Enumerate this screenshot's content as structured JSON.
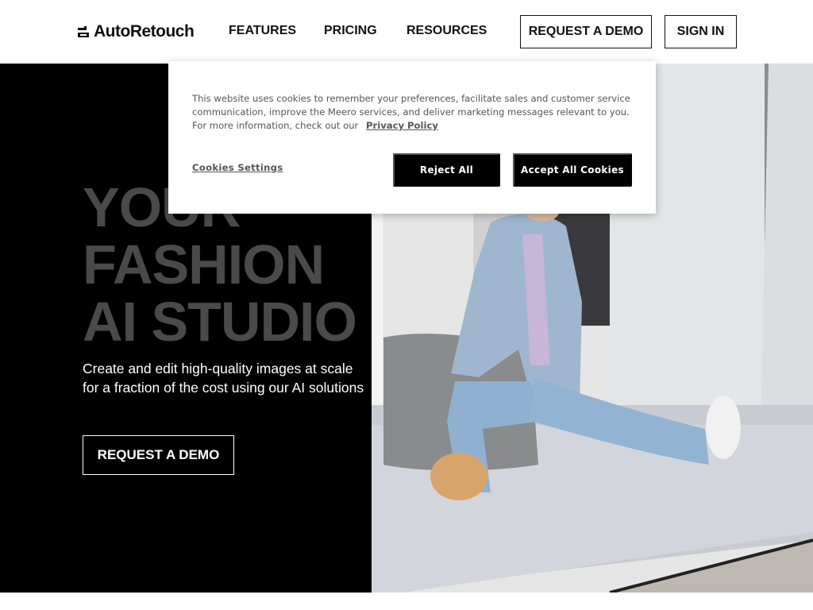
{
  "header": {
    "logo_text": "AutoRetouch",
    "nav": {
      "features": "FEATURES",
      "pricing": "PRICING",
      "resources": "RESOURCES"
    },
    "request_demo": "REQUEST A DEMO",
    "sign_in": "SIGN IN"
  },
  "hero": {
    "title_lines": [
      "YOUR",
      "FASHION",
      "AI STUDIO"
    ],
    "subtitle_lines": [
      "Create and edit high-quality images at scale",
      "for a fraction of the cost using our AI solutions"
    ],
    "cta": "REQUEST A DEMO",
    "photo_icon": "fashion-model-photo"
  },
  "cookie_banner": {
    "text": "This website uses cookies to remember your preferences, facilitate sales and customer service communication, improve the Meero services, and deliver marketing messages relevant to you. For more information, check out our",
    "policy_link": "Privacy Policy",
    "settings_link": "Cookies Settings",
    "reject_label": "Reject All",
    "accept_label": "Accept All Cookies"
  },
  "colors": {
    "hero_bg": "#000000",
    "hero_title": "#4a4a4a",
    "accent": "#000000"
  }
}
